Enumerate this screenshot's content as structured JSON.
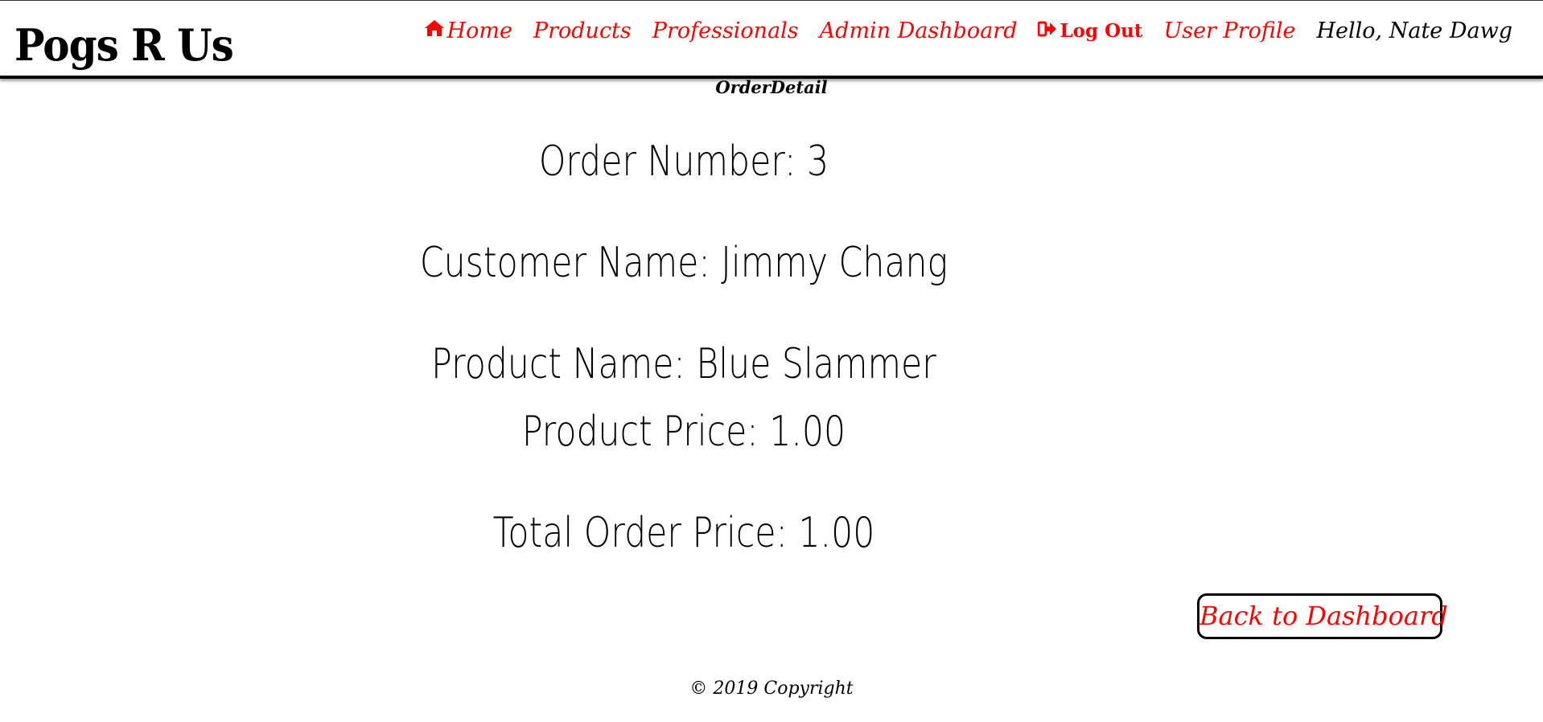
{
  "brand": {
    "title": "Pogs R Us"
  },
  "nav": {
    "home_label": "Home",
    "home_icon": "home-icon",
    "products_label": "Products",
    "professionals_label": "Professionals",
    "admin_label": "Admin Dashboard",
    "logout_label": "Log Out",
    "logout_icon": "sign-out-icon",
    "profile_label": "User Profile",
    "greeting": "Hello, Nate Dawg"
  },
  "page": {
    "label": "OrderDetail"
  },
  "order": {
    "order_number": "Order Number: 3",
    "customer_name": "Customer Name: Jimmy Chang",
    "product_name": "Product Name: Blue Slammer",
    "product_price": "Product Price: 1.00",
    "total_price": "Total Order Price: 1.00"
  },
  "actions": {
    "back_label": "Back to Dashboard"
  },
  "footer": {
    "copyright": "© 2019 Copyright"
  },
  "colors": {
    "link": "#ff0000",
    "text": "#000000",
    "background": "#ffffff"
  }
}
